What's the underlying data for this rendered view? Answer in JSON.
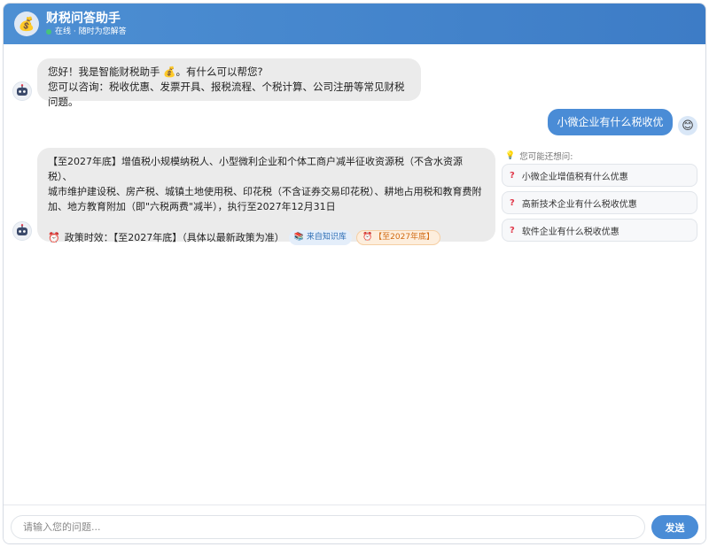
{
  "header": {
    "logo_emoji": "💰",
    "title": "财税问答助手",
    "status": "在线 · 随时为您解答",
    "colors": {
      "header_gradient_start": "#4d8fd3",
      "header_gradient_end": "#3d7cc6",
      "status_dot": "#46c47a"
    }
  },
  "messages": {
    "greeting": {
      "line1": "您好！我是智能财税助手 💰。有什么可以帮您?",
      "line2": "您可以咨询：税收优惠、发票开具、报税流程、个税计算、公司注册等常见财税问题。"
    },
    "user_question": {
      "text": "小微企业有什么税收优惠",
      "avatar_emoji": "😊"
    },
    "answer": {
      "line1": "【至2027年底】增值税小规模纳税人、小型微利企业和个体工商户减半征收资源税（不含水资源税）、",
      "line2": "城市维护建设税、房产税、城镇土地使用税、印花税（不含证券交易印花税）、耕地占用税和教育费附",
      "line3": "加、地方教育附加（即\"六税两费\"减半），执行至2027年12月31日",
      "policy_prefix": "政策时效：【至2027年底】（具体以最新政策为准）",
      "tag_source": "来自知识库",
      "tag_time": "【至2027年底】",
      "clock_icon": "⏰"
    }
  },
  "suggestions": {
    "title": "您可能还想问:",
    "items": [
      "小微企业增值税有什么优惠",
      "高新技术企业有什么税收优惠",
      "软件企业有什么税收优惠"
    ],
    "item_mark": "?"
  },
  "footer": {
    "placeholder": "请输入您的问题...",
    "send_label": "发送",
    "accent_color": "#4a8cd6"
  }
}
